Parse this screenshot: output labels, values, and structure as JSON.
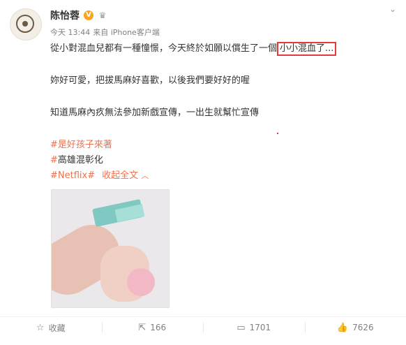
{
  "post": {
    "author": "陈怡蓉",
    "verified_badge": "V",
    "meta": {
      "time": "今天 13:44",
      "source": "来自 iPhone客户端"
    },
    "text": {
      "line1_prefix": "從小對混血兒都有一種憧憬，今天終於如願以償生了一個",
      "line1_highlight": "小小混血了...",
      "line2": "妳好可愛，把拔馬麻好喜歡，以後我們要好好的喔",
      "line3": "知道馬麻內疚無法參加新戲宣傳，一出生就幫忙宣傳",
      "tag1": "#是好孩子來著",
      "tag2_hash": "#",
      "tag2_text": "高雄混彰化",
      "tag3": "#Netflix#",
      "collapse": "收起全文"
    },
    "icons": {
      "more": "chevron-down-icon",
      "crown": "crown-icon"
    }
  },
  "actions": {
    "favorite": {
      "label": "收藏",
      "icon": "star-icon"
    },
    "repost": {
      "count": "166",
      "icon": "repost-icon"
    },
    "comment": {
      "count": "1701",
      "icon": "comment-icon"
    },
    "like": {
      "count": "7626",
      "icon": "thumbs-up-icon"
    }
  },
  "colors": {
    "accent": "#eb7350",
    "highlight_border": "#e23b3b",
    "verified": "#f5a623"
  }
}
